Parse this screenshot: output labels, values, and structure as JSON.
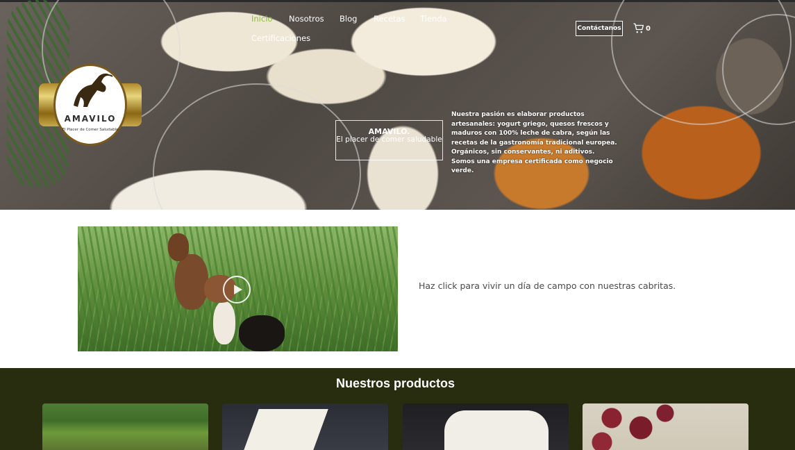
{
  "nav": {
    "items": [
      {
        "label": "Inicio",
        "active": true
      },
      {
        "label": "Nosotros",
        "active": false
      },
      {
        "label": "Blog",
        "active": false
      },
      {
        "label": "Recetas",
        "active": false
      },
      {
        "label": "Tienda",
        "active": false
      },
      {
        "label": "Certificaciones",
        "active": false
      }
    ],
    "contact_label": "Contáctanos",
    "cart_count": "0"
  },
  "logo": {
    "name": "AMAVILO",
    "tagline": "El Placer de Comer Saludable"
  },
  "hero": {
    "brand_title": "AMAVILO.",
    "brand_subtitle": "El placer de comer saludable",
    "description": "Nuestra pasión es elaborar productos artesanales: yogurt griego, quesos frescos y maduros con 100% leche de cabra, según las recetas de la gastronomía tradicional europea. Orgánicos, sin conservantes, ni aditivos.",
    "description_2": "Somos una empresa certificada como negocio verde."
  },
  "video": {
    "caption": "Haz click para vivir un día de campo con nuestras cabritas."
  },
  "products": {
    "title": "Nuestros productos",
    "cards": [
      {
        "name": "product-card-1"
      },
      {
        "name": "product-card-2"
      },
      {
        "name": "product-card-3"
      },
      {
        "name": "product-card-4"
      }
    ]
  },
  "colors": {
    "accent": "#8bbf3c",
    "products_bg": "#272d0e",
    "logo_gold": "#b08a2a"
  }
}
